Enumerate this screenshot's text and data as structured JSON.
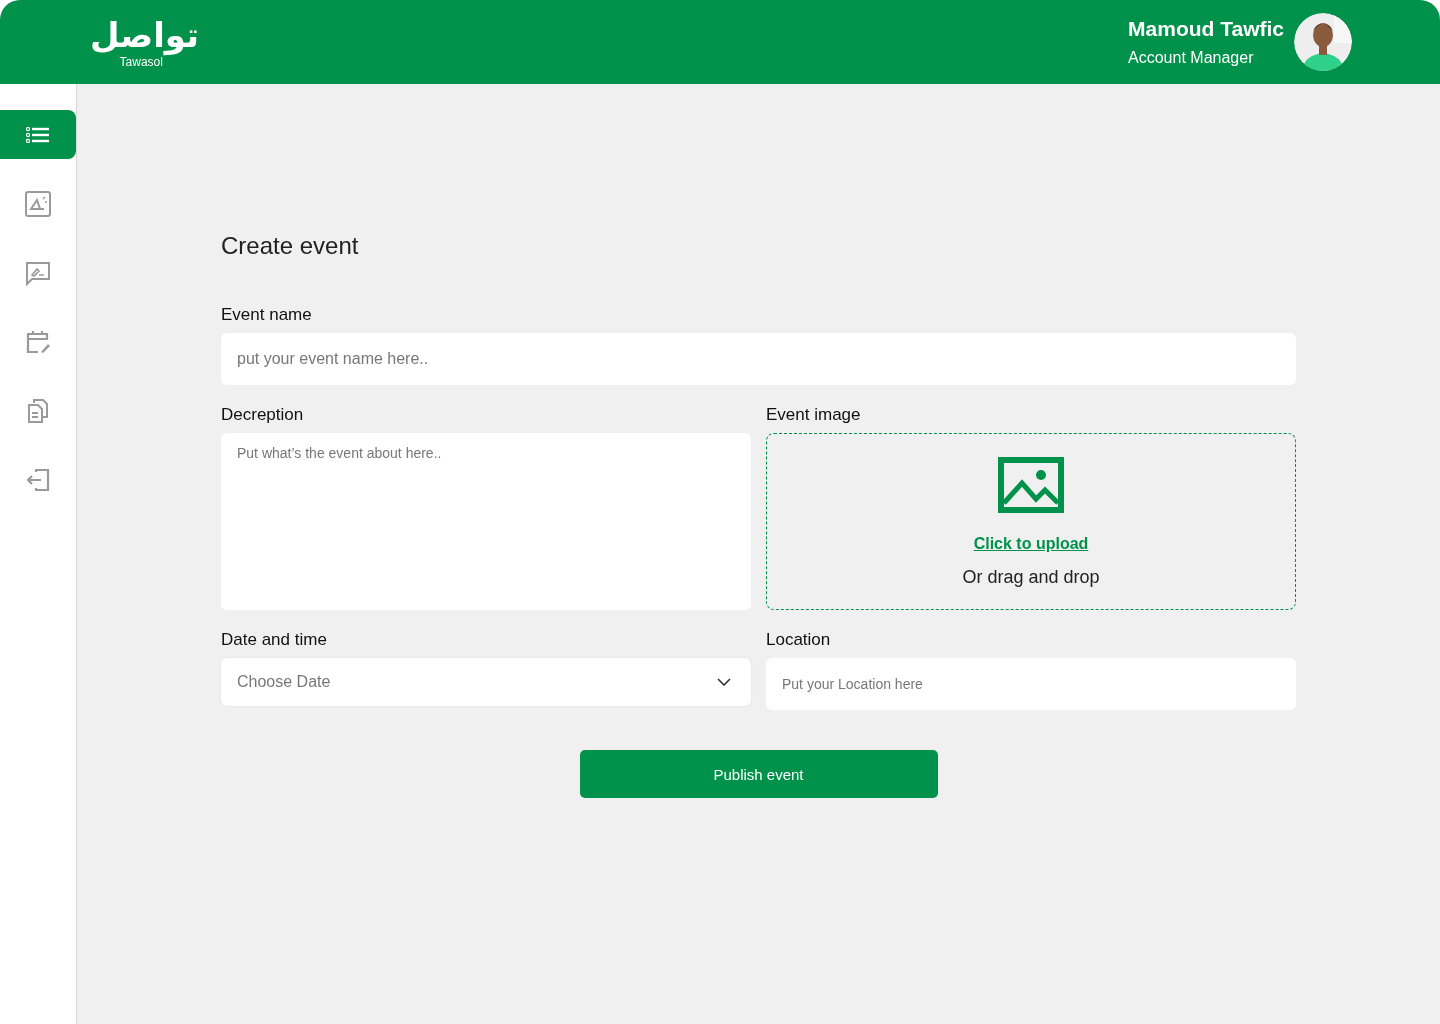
{
  "header": {
    "logo": {
      "arabic": "تواصل",
      "latin": "Tawasol"
    },
    "user": {
      "name": "Mamoud Tawfic",
      "role": "Account Manager"
    }
  },
  "sidebar": {
    "items": [
      {
        "kind": "list",
        "selected": true
      },
      {
        "kind": "announce",
        "selected": false
      },
      {
        "kind": "comment",
        "selected": false
      },
      {
        "kind": "calendar",
        "selected": false
      },
      {
        "kind": "documents",
        "selected": false
      },
      {
        "kind": "logout",
        "selected": false
      }
    ]
  },
  "form": {
    "title": "Create event",
    "event_name": {
      "label": "Event name",
      "placeholder": "put your event name here.."
    },
    "description": {
      "label": "Decreption",
      "placeholder": "Put what’s the event about here.."
    },
    "event_image": {
      "label": "Event image",
      "upload_link": "Click to upload",
      "hint": "Or drag and drop"
    },
    "date_time": {
      "label": "Date and time",
      "placeholder": "Choose Date"
    },
    "location": {
      "label": "Location",
      "placeholder": "Put your Location here"
    },
    "submit": "Publish event"
  }
}
